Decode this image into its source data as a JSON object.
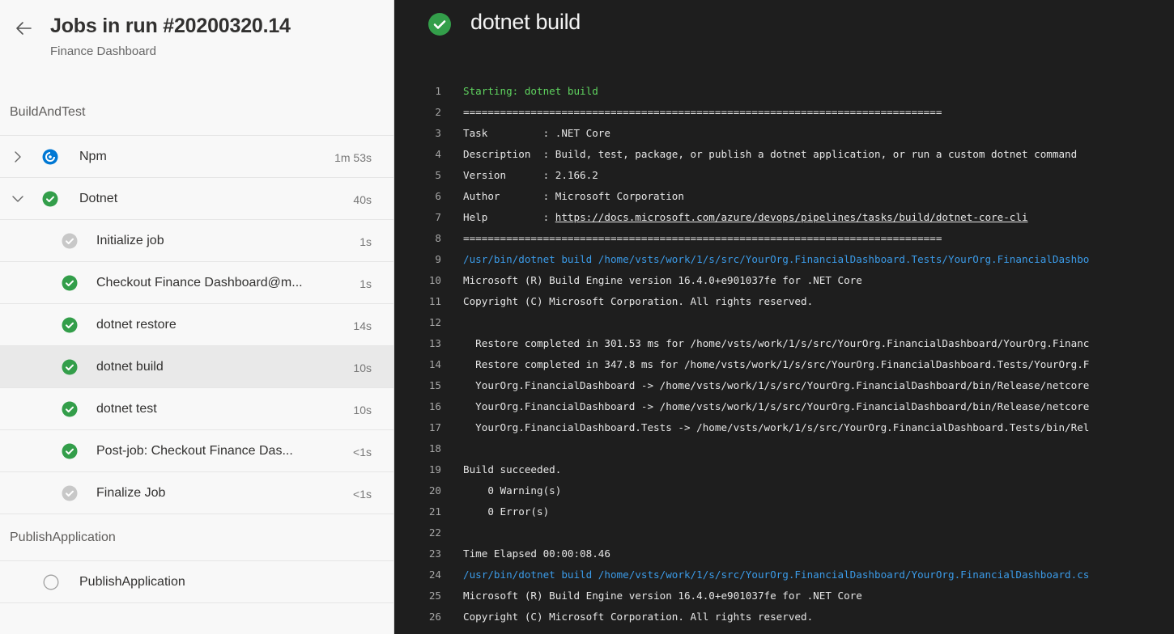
{
  "sidebar": {
    "title": "Jobs in run #20200320.14",
    "subtitle": "Finance Dashboard",
    "stages": [
      {
        "name": "BuildAndTest",
        "jobs": [
          {
            "label": "Npm",
            "duration": "1m 53s",
            "status": "running",
            "expanded": false
          },
          {
            "label": "Dotnet",
            "duration": "40s",
            "status": "succeeded",
            "expanded": true,
            "steps": [
              {
                "label": "Initialize job",
                "duration": "1s",
                "status": "skipped"
              },
              {
                "label": "Checkout Finance Dashboard@m...",
                "duration": "1s",
                "status": "succeeded"
              },
              {
                "label": "dotnet restore",
                "duration": "14s",
                "status": "succeeded"
              },
              {
                "label": "dotnet build",
                "duration": "10s",
                "status": "succeeded",
                "selected": true
              },
              {
                "label": "dotnet test",
                "duration": "10s",
                "status": "succeeded"
              },
              {
                "label": "Post-job: Checkout Finance Das...",
                "duration": "<1s",
                "status": "succeeded"
              },
              {
                "label": "Finalize Job",
                "duration": "<1s",
                "status": "skipped"
              }
            ]
          }
        ]
      },
      {
        "name": "PublishApplication",
        "jobs": [
          {
            "label": "PublishApplication",
            "duration": "",
            "status": "pending",
            "expanded": false
          }
        ]
      }
    ]
  },
  "log": {
    "title": "dotnet build",
    "status": "succeeded",
    "lines": [
      {
        "n": "1",
        "text": "Starting: dotnet build",
        "style": "green"
      },
      {
        "n": "2",
        "text": "==============================================================================",
        "style": ""
      },
      {
        "n": "3",
        "text": "Task         : .NET Core",
        "style": ""
      },
      {
        "n": "4",
        "text": "Description  : Build, test, package, or publish a dotnet application, or run a custom dotnet command",
        "style": ""
      },
      {
        "n": "5",
        "text": "Version      : 2.166.2",
        "style": ""
      },
      {
        "n": "6",
        "text": "Author       : Microsoft Corporation",
        "style": ""
      },
      {
        "n": "7",
        "text": "Help         : https://docs.microsoft.com/azure/devops/pipelines/tasks/build/dotnet-core-cli",
        "style": "",
        "link": "https://docs.microsoft.com/azure/devops/pipelines/tasks/build/dotnet-core-cli"
      },
      {
        "n": "8",
        "text": "==============================================================================",
        "style": ""
      },
      {
        "n": "9",
        "text": "/usr/bin/dotnet build /home/vsts/work/1/s/src/YourOrg.FinancialDashboard.Tests/YourOrg.FinancialDashbo",
        "style": "blue"
      },
      {
        "n": "10",
        "text": "Microsoft (R) Build Engine version 16.4.0+e901037fe for .NET Core",
        "style": ""
      },
      {
        "n": "11",
        "text": "Copyright (C) Microsoft Corporation. All rights reserved.",
        "style": ""
      },
      {
        "n": "12",
        "text": "",
        "style": ""
      },
      {
        "n": "13",
        "text": "  Restore completed in 301.53 ms for /home/vsts/work/1/s/src/YourOrg.FinancialDashboard/YourOrg.Financ",
        "style": ""
      },
      {
        "n": "14",
        "text": "  Restore completed in 347.8 ms for /home/vsts/work/1/s/src/YourOrg.FinancialDashboard.Tests/YourOrg.F",
        "style": ""
      },
      {
        "n": "15",
        "text": "  YourOrg.FinancialDashboard -> /home/vsts/work/1/s/src/YourOrg.FinancialDashboard/bin/Release/netcore",
        "style": ""
      },
      {
        "n": "16",
        "text": "  YourOrg.FinancialDashboard -> /home/vsts/work/1/s/src/YourOrg.FinancialDashboard/bin/Release/netcore",
        "style": ""
      },
      {
        "n": "17",
        "text": "  YourOrg.FinancialDashboard.Tests -> /home/vsts/work/1/s/src/YourOrg.FinancialDashboard.Tests/bin/Rel",
        "style": ""
      },
      {
        "n": "18",
        "text": "",
        "style": ""
      },
      {
        "n": "19",
        "text": "Build succeeded.",
        "style": ""
      },
      {
        "n": "20",
        "text": "    0 Warning(s)",
        "style": ""
      },
      {
        "n": "21",
        "text": "    0 Error(s)",
        "style": ""
      },
      {
        "n": "22",
        "text": "",
        "style": ""
      },
      {
        "n": "23",
        "text": "Time Elapsed 00:00:08.46",
        "style": ""
      },
      {
        "n": "24",
        "text": "/usr/bin/dotnet build /home/vsts/work/1/s/src/YourOrg.FinancialDashboard/YourOrg.FinancialDashboard.cs",
        "style": "blue"
      },
      {
        "n": "25",
        "text": "Microsoft (R) Build Engine version 16.4.0+e901037fe for .NET Core",
        "style": ""
      },
      {
        "n": "26",
        "text": "Copyright (C) Microsoft Corporation. All rights reserved.",
        "style": ""
      }
    ]
  },
  "icons": {
    "back": "arrow-left-icon",
    "expand": "chevron-right-icon",
    "collapse": "chevron-down-icon",
    "succeeded": "check-circle-icon",
    "running": "running-circle-icon",
    "skipped": "check-circle-gray-icon",
    "pending": "empty-circle-icon"
  },
  "colors": {
    "success": "#339e4a",
    "running": "#0078d4",
    "skipped": "#c8c8c8",
    "log_green": "#5fd35f",
    "log_blue": "#3b9be8",
    "log_background": "#1e1e1e",
    "sidebar_background": "#f8f8f8",
    "selected_row": "#e9e9e9"
  }
}
